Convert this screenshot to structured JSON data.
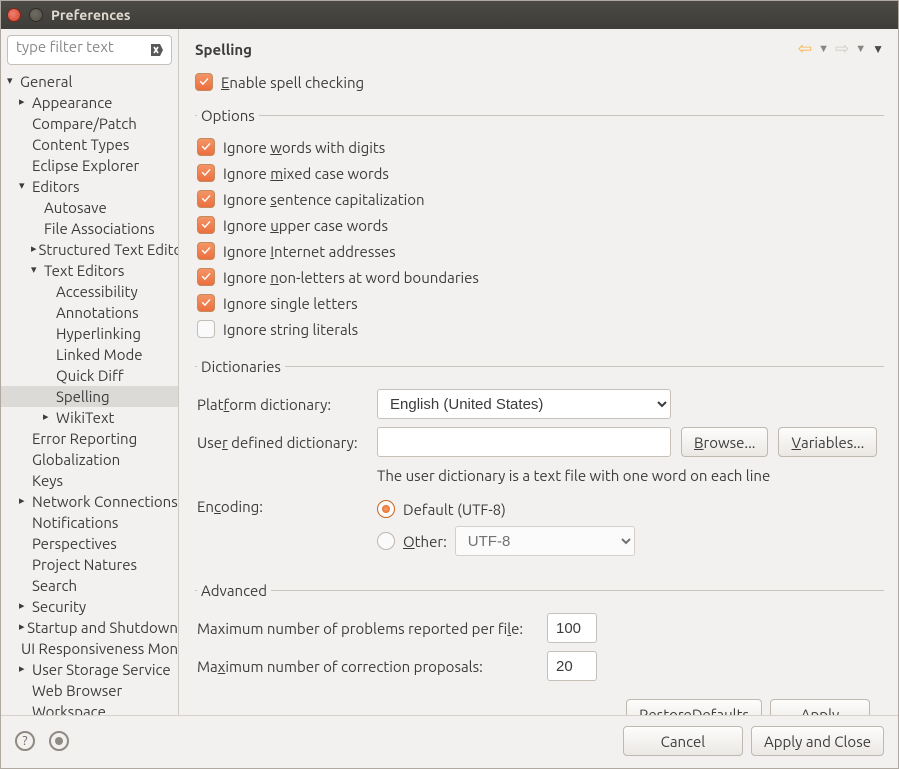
{
  "window": {
    "title": "Preferences"
  },
  "filter": {
    "placeholder": "type filter text"
  },
  "tree": {
    "general": "General",
    "appearance": "Appearance",
    "compare_patch": "Compare/Patch",
    "content_types": "Content Types",
    "eclipse_explorer": "Eclipse Explorer",
    "editors": "Editors",
    "autosave": "Autosave",
    "file_assoc": "File Associations",
    "structured": "Structured Text Editors",
    "text_editors": "Text Editors",
    "accessibility": "Accessibility",
    "annotations": "Annotations",
    "hyperlinking": "Hyperlinking",
    "linked_mode": "Linked Mode",
    "quick_diff": "Quick Diff",
    "spelling": "Spelling",
    "wikitext": "WikiText",
    "error_reporting": "Error Reporting",
    "globalization": "Globalization",
    "keys": "Keys",
    "network": "Network Connections",
    "notifications": "Notifications",
    "perspectives": "Perspectives",
    "project_natures": "Project Natures",
    "search": "Search",
    "security": "Security",
    "startup": "Startup and Shutdown",
    "ui_resp": "UI Responsiveness Monitoring",
    "user_storage": "User Storage Service",
    "web_browser": "Web Browser",
    "workspace": "Workspace"
  },
  "header": {
    "title": "Spelling"
  },
  "top": {
    "enable_pre": "E",
    "enable_post": "nable spell checking"
  },
  "options": {
    "legend": "Options",
    "digits_pre": "Ignore ",
    "digits_u": "w",
    "digits_post": "ords with digits",
    "mixed_pre": "Ignore ",
    "mixed_u": "m",
    "mixed_post": "ixed case words",
    "sent_pre": "Ignore ",
    "sent_u": "s",
    "sent_post": "entence capitalization",
    "upper_pre": "Ignore ",
    "upper_u": "u",
    "upper_post": "pper case words",
    "inet_pre": "Ignore ",
    "inet_u": "I",
    "inet_post": "nternet addresses",
    "nonl_pre": "Ignore ",
    "nonl_u": "n",
    "nonl_post": "on-letters at word boundaries",
    "single_pre": "Ignore sin",
    "single_u": "g",
    "single_post": "le letters",
    "string": "Ignore string literals"
  },
  "dict": {
    "legend": "Dictionaries",
    "platform_pre": "Plat",
    "platform_u": "f",
    "platform_post": "orm dictionary:",
    "platform_value": "English (United States)",
    "user_pre": "Use",
    "user_u": "r",
    "user_post": " defined dictionary:",
    "user_value": "",
    "browse_u": "B",
    "browse_post": "rowse...",
    "vars_u": "V",
    "vars_post": "ariables...",
    "note": "The user dictionary is a text file with one word on each line",
    "enc_pre": "En",
    "enc_u": "c",
    "enc_post": "oding:",
    "enc_default": "Default (UTF-8)",
    "enc_other_u": "O",
    "enc_other_post": "ther:",
    "enc_other_value": "UTF-8"
  },
  "adv": {
    "legend": "Advanced",
    "max_problems_pre": "Maximum number of problems reported per fi",
    "max_problems_u": "l",
    "max_problems_post": "e:",
    "max_problems_value": "100",
    "max_props_pre": "Ma",
    "max_props_u": "x",
    "max_props_post": "imum number of correction proposals:",
    "max_props_value": "20"
  },
  "buttons": {
    "restore_pre": "Restore ",
    "restore_u": "D",
    "restore_post": "efaults",
    "apply_u": "A",
    "apply_post": "pply",
    "cancel": "Cancel",
    "apply_close": "Apply and Close"
  }
}
